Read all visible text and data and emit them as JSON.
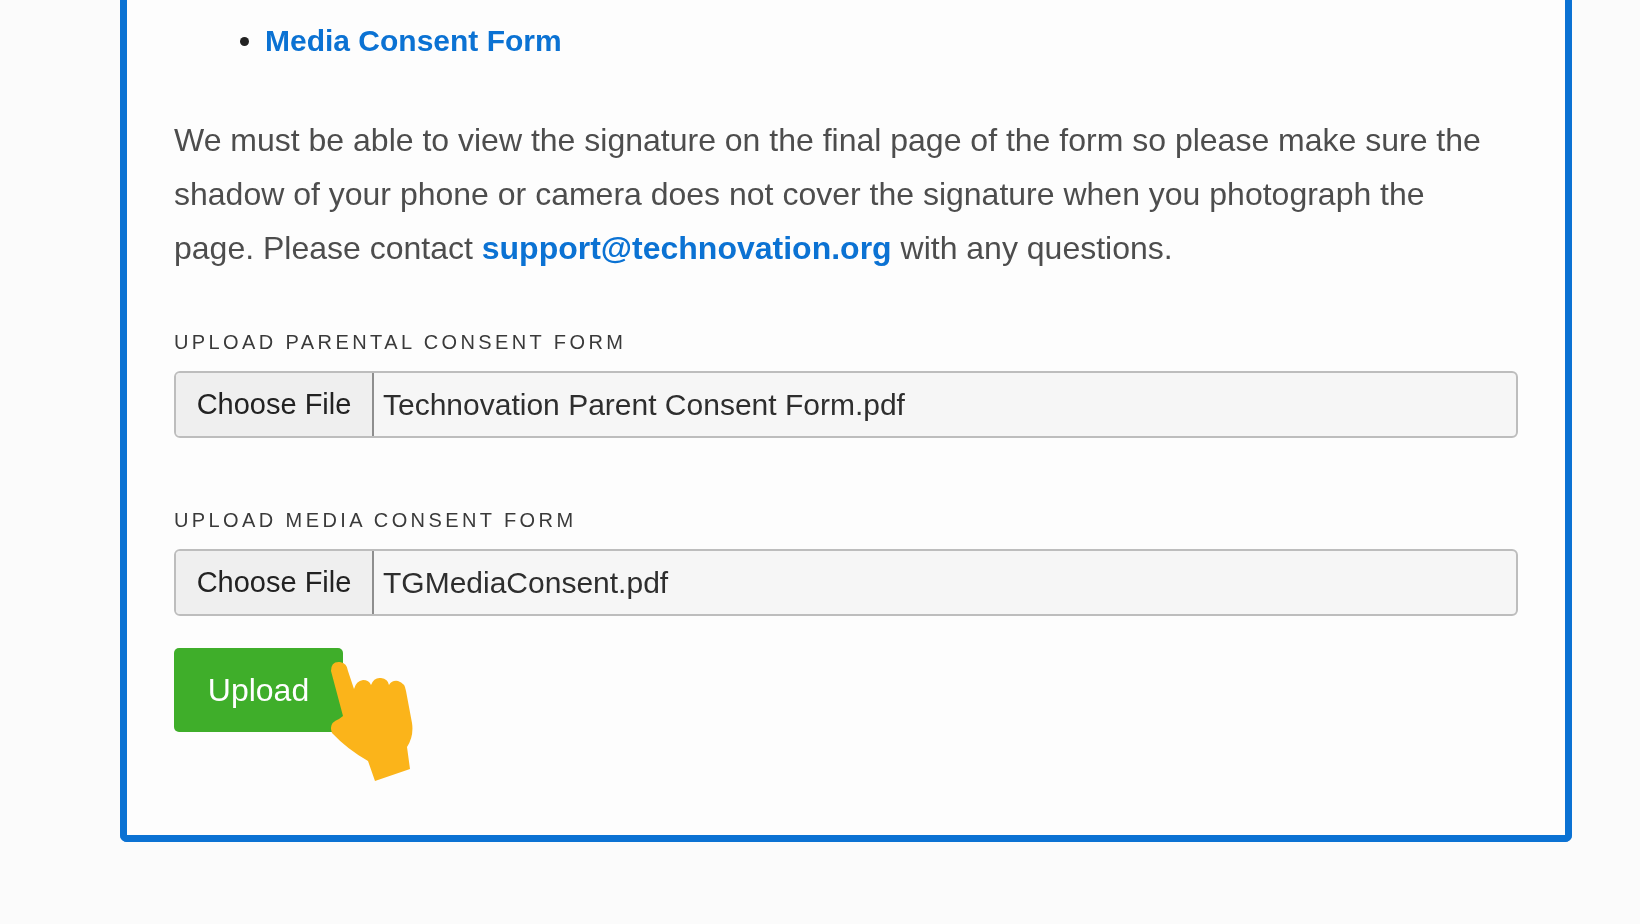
{
  "consent_links": [
    {
      "label": "Media Consent Form"
    }
  ],
  "instructions": {
    "text_before": "We must be able to view the signature on the final page of the form so please make sure the shadow of your phone or camera does not cover the signature when you photograph the page. Please contact ",
    "email": "support@technovation.org",
    "text_after": " with any questions."
  },
  "uploads": [
    {
      "label": "UPLOAD PARENTAL CONSENT FORM",
      "button": "Choose File",
      "file_name": "Technovation Parent Consent Form.pdf"
    },
    {
      "label": "UPLOAD MEDIA CONSENT FORM",
      "button": "Choose File",
      "file_name": "TGMediaConsent.pdf"
    }
  ],
  "submit_button": "Upload"
}
